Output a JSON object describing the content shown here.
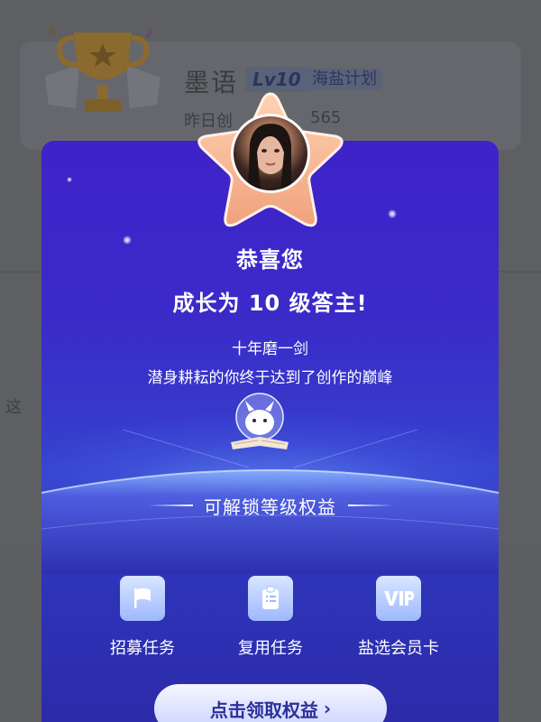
{
  "background": {
    "username": "墨语",
    "level_badge": "Lv10",
    "plan_tag": "海盐计划",
    "stat_label": "昨日创",
    "stat_value": "565",
    "side_text": "这"
  },
  "modal": {
    "congrats": "恭喜您",
    "headline": "成长为 10 级答主!",
    "slogan_line1": "十年磨一剑",
    "slogan_line2": "潜身耕耘的你终于达到了创作的巅峰",
    "benefits_title": "可解锁等级权益",
    "benefits": [
      {
        "label": "招募任务",
        "icon": "flag-icon"
      },
      {
        "label": "复用任务",
        "icon": "clipboard-icon"
      },
      {
        "label": "盐选会员卡",
        "icon": "vip-icon"
      }
    ],
    "cta_label": "点击领取权益",
    "cta_arrow": "›"
  },
  "colors": {
    "modal_top": "#3f22c9",
    "modal_bottom": "#2c2aa8",
    "star": "#f3b08a",
    "cta_text": "#2c2f9c"
  }
}
